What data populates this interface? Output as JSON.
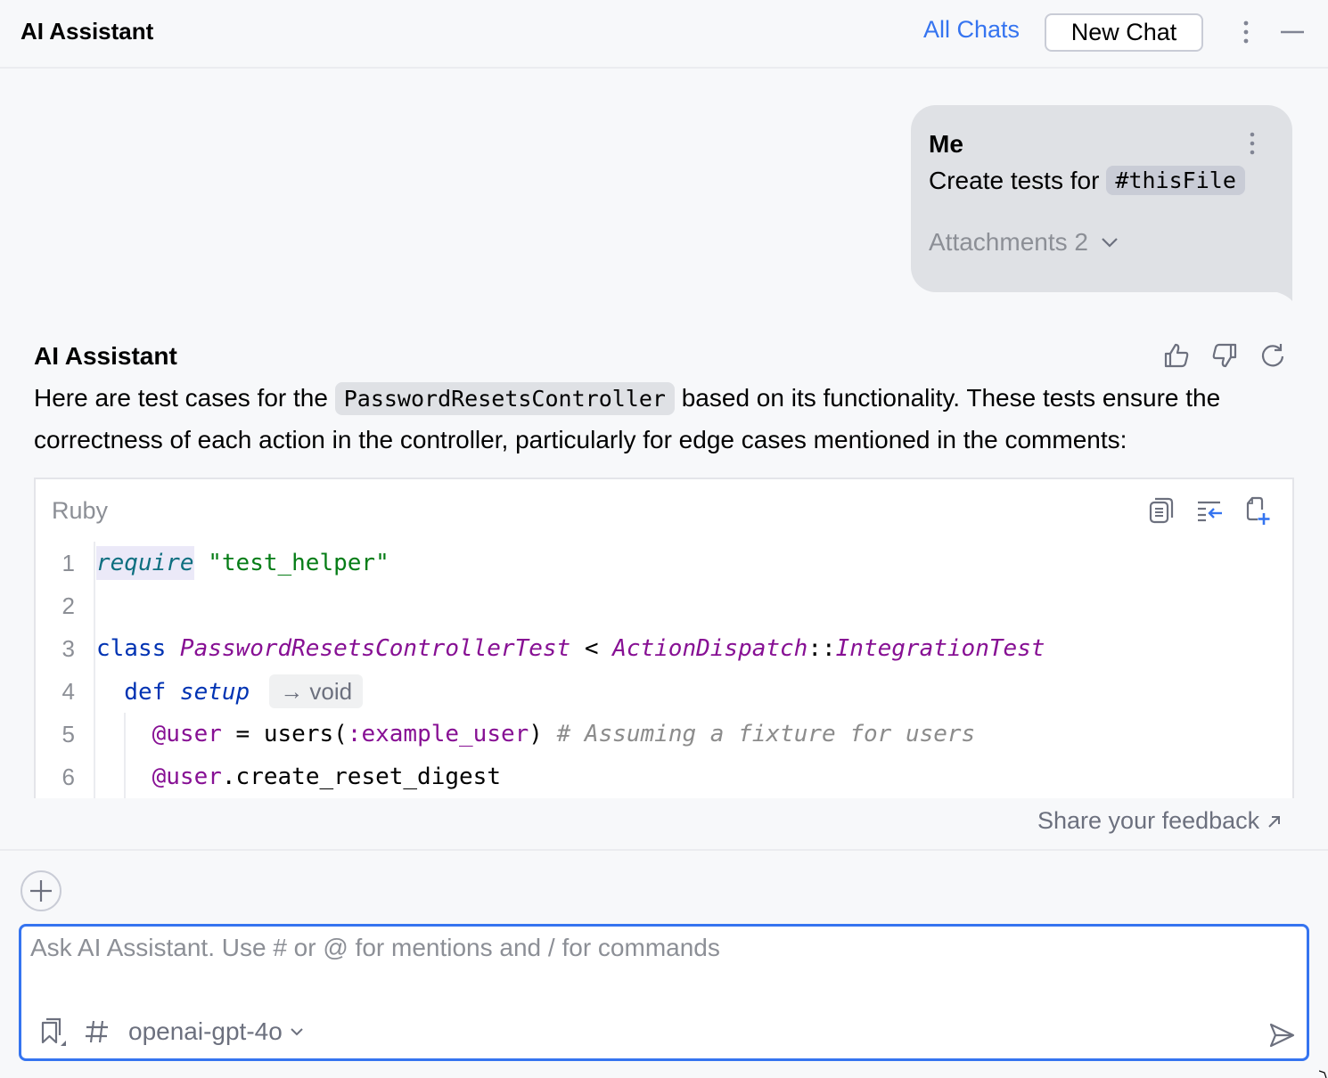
{
  "header": {
    "title": "AI Assistant",
    "all_chats": "All Chats",
    "new_chat": "New Chat"
  },
  "user_message": {
    "author": "Me",
    "text": "Create tests for",
    "mention": "#thisFile",
    "attachments_label": "Attachments 2"
  },
  "ai_message": {
    "author": "AI Assistant",
    "text_before": "Here are test cases for the ",
    "inline_code": "PasswordResetsController",
    "text_after": " based on its functionality. These tests ensure the correctness of each action in the controller, particularly for edge cases mentioned in the comments:",
    "code_block": {
      "language": "Ruby",
      "lines": [
        {
          "no": "1",
          "tokens": [
            {
              "t": "require",
              "c": "kw-req"
            },
            {
              "t": " ",
              "c": ""
            },
            {
              "t": "\"test_helper\"",
              "c": "str"
            }
          ]
        },
        {
          "no": "2",
          "tokens": []
        },
        {
          "no": "3",
          "tokens": [
            {
              "t": "class ",
              "c": "kw"
            },
            {
              "t": "PasswordResetsControllerTest",
              "c": "cls"
            },
            {
              "t": " < ",
              "c": ""
            },
            {
              "t": "ActionDispatch",
              "c": "cls"
            },
            {
              "t": "::",
              "c": ""
            },
            {
              "t": "IntegrationTest",
              "c": "cls"
            }
          ]
        },
        {
          "no": "4",
          "tokens": [
            {
              "t": "  def ",
              "c": "kw"
            },
            {
              "t": "setup",
              "c": "fn"
            }
          ],
          "hint": "→ void"
        },
        {
          "no": "5",
          "tokens": [
            {
              "t": "    ",
              "c": ""
            },
            {
              "t": "@user",
              "c": "ivar"
            },
            {
              "t": " = users(",
              "c": ""
            },
            {
              "t": ":example_user",
              "c": "sym"
            },
            {
              "t": ") ",
              "c": ""
            },
            {
              "t": "# Assuming a fixture for users",
              "c": "cmt"
            }
          ]
        },
        {
          "no": "6",
          "tokens": [
            {
              "t": "    ",
              "c": ""
            },
            {
              "t": "@user",
              "c": "ivar"
            },
            {
              "t": ".create_reset_digest",
              "c": ""
            }
          ]
        }
      ]
    }
  },
  "feedback_link": "Share your feedback",
  "input": {
    "placeholder": "Ask AI Assistant. Use # or @ for mentions and / for commands",
    "value": "",
    "model": "openai-gpt-4o"
  },
  "colors": {
    "accent": "#3574f0",
    "bubble": "#dfe1e5",
    "background": "#f7f8fa"
  }
}
